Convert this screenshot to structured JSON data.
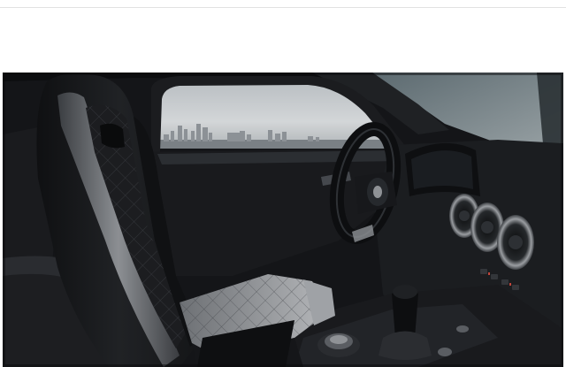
{
  "image": {
    "subject": "car-interior-photo",
    "palette": {
      "cabin_dark": "#15171a",
      "cabin_mid": "#2a2d31",
      "leather": "#1c1d20",
      "stitch": "#3c3f44",
      "sky": "#c9ccce",
      "skyline": "#8e9398",
      "trim_silver": "#8f9296",
      "accent_red": "#c0453b"
    }
  }
}
